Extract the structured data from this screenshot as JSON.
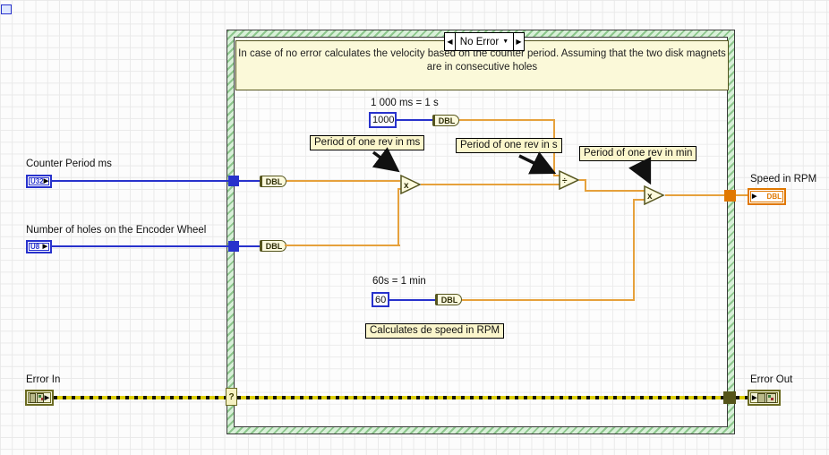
{
  "case_structure": {
    "selector": {
      "value": "No Error",
      "prev_arrow": "◀",
      "next_arrow": "▶",
      "dropdown_arrow": "▼"
    },
    "comment": "In case of no error calculates the velocity based on the counter period. Assuming that the two disk magnets are in consecutive holes",
    "selector_tunnel": "?"
  },
  "terminals": {
    "counter_period": {
      "label": "Counter Period ms",
      "type": "U32",
      "arrow": "▶"
    },
    "num_holes": {
      "label": "Number of holes on the Encoder Wheel",
      "type": "U8",
      "arrow": "▶"
    },
    "speed": {
      "label": "Speed in RPM",
      "type": "DBL",
      "arrow": "▶"
    },
    "error_in": {
      "label": "Error In",
      "arrow": "▶"
    },
    "error_out": {
      "label": "Error Out",
      "arrow": "▶"
    }
  },
  "constants": {
    "ms": {
      "value": "1000",
      "caption": "1 000 ms = 1 s"
    },
    "sec": {
      "value": "60",
      "caption": "60s = 1 min"
    }
  },
  "conversion_label": "DBL",
  "operators": {
    "multiply1": "x",
    "divide": "÷",
    "multiply2": "x"
  },
  "annotations": {
    "rev_ms": "Period of one rev in ms",
    "rev_s": "Period of one rev in s",
    "rev_min": "Period of one rev in min",
    "calc": "Calculates de speed in RPM"
  },
  "colors": {
    "int_wire": "#2832cc",
    "dbl_wire": "#e6a13c",
    "dbl_terminal": "#e07800",
    "error_wire": "#ddcf00",
    "structure_green": "#8cc68c",
    "node_fill": "#fcfadd",
    "comment_fill": "#fbf9d9"
  }
}
